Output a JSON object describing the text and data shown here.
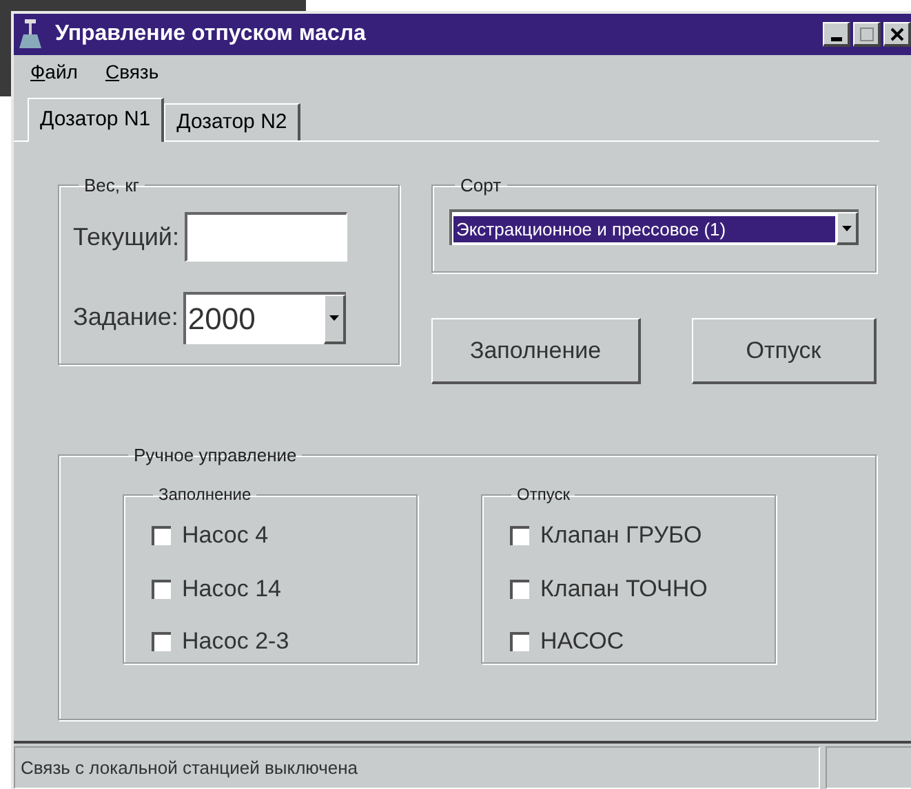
{
  "window": {
    "title": "Управление отпуском масла"
  },
  "menu": [
    {
      "label": "Файл"
    },
    {
      "label": "Связь"
    }
  ],
  "tabs": [
    {
      "label": "Дозатор N1",
      "selected": true
    },
    {
      "label": "Дозатор N2",
      "selected": false
    }
  ],
  "weight": {
    "legend": "Вес, кг",
    "current": {
      "label": "Текущий:"
    },
    "setpoint": {
      "label": "Задание:",
      "value": "2000"
    }
  },
  "grade": {
    "legend": "Сорт",
    "value": "Экстракционное и прессовое (1)"
  },
  "buttons": [
    "Заполнение",
    "Отпуск"
  ],
  "manual": {
    "legend": "Ручное управление",
    "groups": [
      {
        "legend": "Заполнение",
        "items": [
          {
            "label": "Насос 4",
            "checked": false
          },
          {
            "label": "Насос 14",
            "checked": false
          },
          {
            "label": "Насос 2-3",
            "checked": false
          }
        ]
      },
      {
        "legend": "Отпуск",
        "items": [
          {
            "label": "Клапан ГРУБО",
            "checked": false
          },
          {
            "label": "Клапан ТОЧНО",
            "checked": false
          },
          {
            "label": "НАСОС",
            "checked": false
          }
        ]
      }
    ]
  },
  "status_bar": {
    "text": "Связь с локальной станцией выключена"
  }
}
